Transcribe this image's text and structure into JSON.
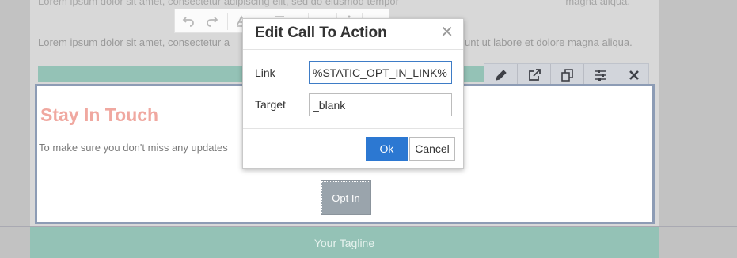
{
  "canvas": {
    "ghost_top_left": "Lorem ipsum dolor sit amet, consectetur adipiscing elit, sed do eiusmod tempor ",
    "ghost_top_right": "magna aliqua.",
    "lorem_left": "Lorem ipsum dolor sit amet, consectetur a",
    "lorem_right": "unt ut labore et dolore magna aliqua.",
    "stay_title": "Stay In Touch",
    "stay_body": "To make sure you don't miss any updates",
    "optin_label": "Opt In",
    "tagline": "Your Tagline"
  },
  "rte_toolbar": {
    "icons": [
      "undo-icon",
      "redo-icon",
      "format-icon",
      "align-icon",
      "more-icon"
    ]
  },
  "block_toolbar": {
    "icons": [
      "pencil-icon",
      "external-link-icon",
      "duplicate-icon",
      "settings-sliders-icon",
      "close-icon"
    ]
  },
  "dialog": {
    "title": "Edit Call To Action",
    "close_symbol": "✕",
    "link_label": "Link",
    "link_value": "%STATIC_OPT_IN_LINK%",
    "target_label": "Target",
    "target_value": "_blank",
    "ok_label": "Ok",
    "cancel_label": "Cancel"
  },
  "colors": {
    "accent_teal": "#94c2b6",
    "title_pink": "#f0a8a0",
    "primary_button": "#2c78d2",
    "selection_border": "#8d9cb5"
  }
}
